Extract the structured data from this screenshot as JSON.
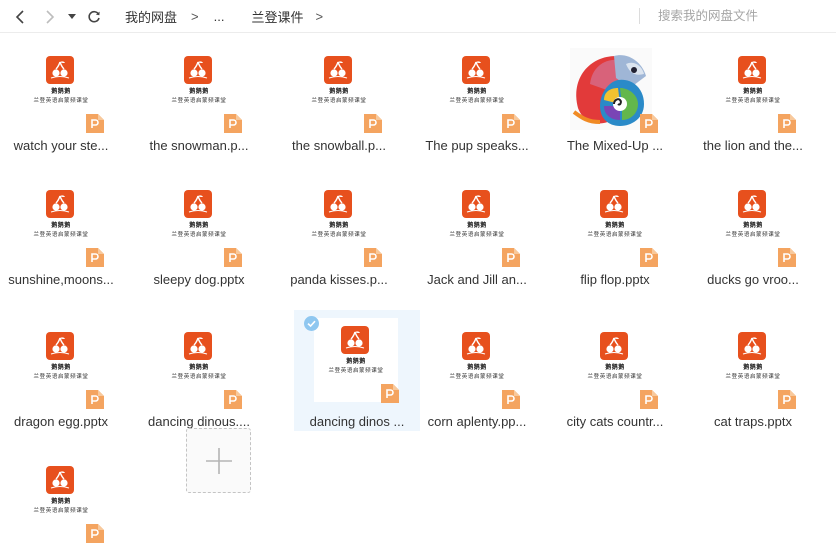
{
  "toolbar": {
    "breadcrumb": [
      "我的网盘",
      "...",
      "兰登课件"
    ],
    "separator": ">",
    "search_placeholder": "搜索我的网盘文件"
  },
  "thumb_text": {
    "line1": "鹅鹅鹅",
    "line2": "兰登英语启蒙频课堂"
  },
  "colors": {
    "accent_orange": "#e7501d",
    "ppt_badge": "#f4a460",
    "selected_bg": "#eef6fd",
    "check_blue": "#8fc7f0"
  },
  "files": [
    {
      "name": "watch your ste...",
      "thumb": "course",
      "selected": false
    },
    {
      "name": "the snowman.p...",
      "thumb": "course",
      "selected": false
    },
    {
      "name": "the snowball.p...",
      "thumb": "course",
      "selected": false
    },
    {
      "name": "The pup speaks...",
      "thumb": "course",
      "selected": false
    },
    {
      "name": "The Mixed-Up ...",
      "thumb": "mixed-up",
      "selected": false
    },
    {
      "name": "the lion and the...",
      "thumb": "course",
      "selected": false
    },
    {
      "name": "sunshine,moons...",
      "thumb": "course",
      "selected": false
    },
    {
      "name": "sleepy dog.pptx",
      "thumb": "course",
      "selected": false
    },
    {
      "name": "panda kisses.p...",
      "thumb": "course",
      "selected": false
    },
    {
      "name": "Jack and Jill an...",
      "thumb": "course",
      "selected": false
    },
    {
      "name": "flip flop.pptx",
      "thumb": "course",
      "selected": false
    },
    {
      "name": "ducks go vroo...",
      "thumb": "course",
      "selected": false
    },
    {
      "name": "dragon egg.pptx",
      "thumb": "course",
      "selected": false
    },
    {
      "name": "dancing dinous....",
      "thumb": "course",
      "selected": false
    },
    {
      "name": "dancing dinos ...",
      "thumb": "course",
      "selected": true
    },
    {
      "name": "corn aplenty.pp...",
      "thumb": "course",
      "selected": false
    },
    {
      "name": "city cats countr...",
      "thumb": "course",
      "selected": false
    },
    {
      "name": "cat traps.pptx",
      "thumb": "course",
      "selected": false
    },
    {
      "name": "",
      "thumb": "course",
      "selected": false
    }
  ],
  "icons": {
    "back": "chevron-left-icon",
    "forward": "chevron-right-icon",
    "history": "caret-down-icon",
    "refresh": "refresh-icon",
    "file_type": "ppt-file-icon",
    "logo": "cherry-logo-icon",
    "add": "plus-icon",
    "check": "check-circle-icon"
  }
}
